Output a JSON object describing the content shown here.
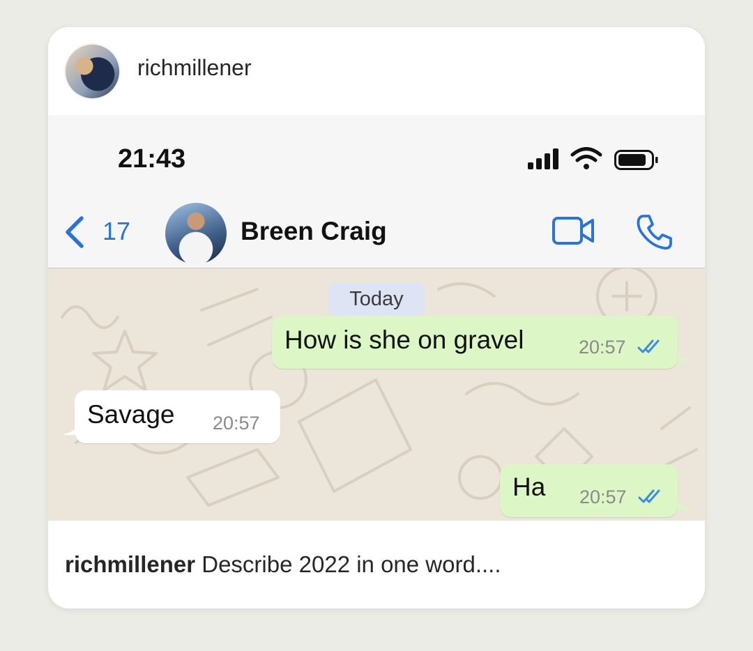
{
  "post": {
    "username": "richmillener",
    "caption_user": "richmillener",
    "caption_text": "Describe 2022 in one word...."
  },
  "status_bar": {
    "time": "21:43",
    "icons": [
      "signal-icon",
      "wifi-icon",
      "battery-icon"
    ]
  },
  "chat_header": {
    "back_count": "17",
    "contact_name": "Breen Craig",
    "icons": [
      "back-chevron-icon",
      "video-call-icon",
      "phone-call-icon"
    ]
  },
  "chat": {
    "date_label": "Today",
    "messages": [
      {
        "direction": "outgoing",
        "text": "How is she on gravel",
        "time": "20:57",
        "read": true
      },
      {
        "direction": "incoming",
        "text": "Savage",
        "time": "20:57"
      },
      {
        "direction": "outgoing",
        "text": "Ha",
        "time": "20:57",
        "read": true
      }
    ]
  },
  "colors": {
    "accent": "#2a74d8",
    "outgoing_bubble": "#dcf7c5",
    "incoming_bubble": "#ffffff",
    "chat_background": "#ece5da",
    "date_pill": "#dfe4f4",
    "read_ticks": "#3b8ce6"
  }
}
